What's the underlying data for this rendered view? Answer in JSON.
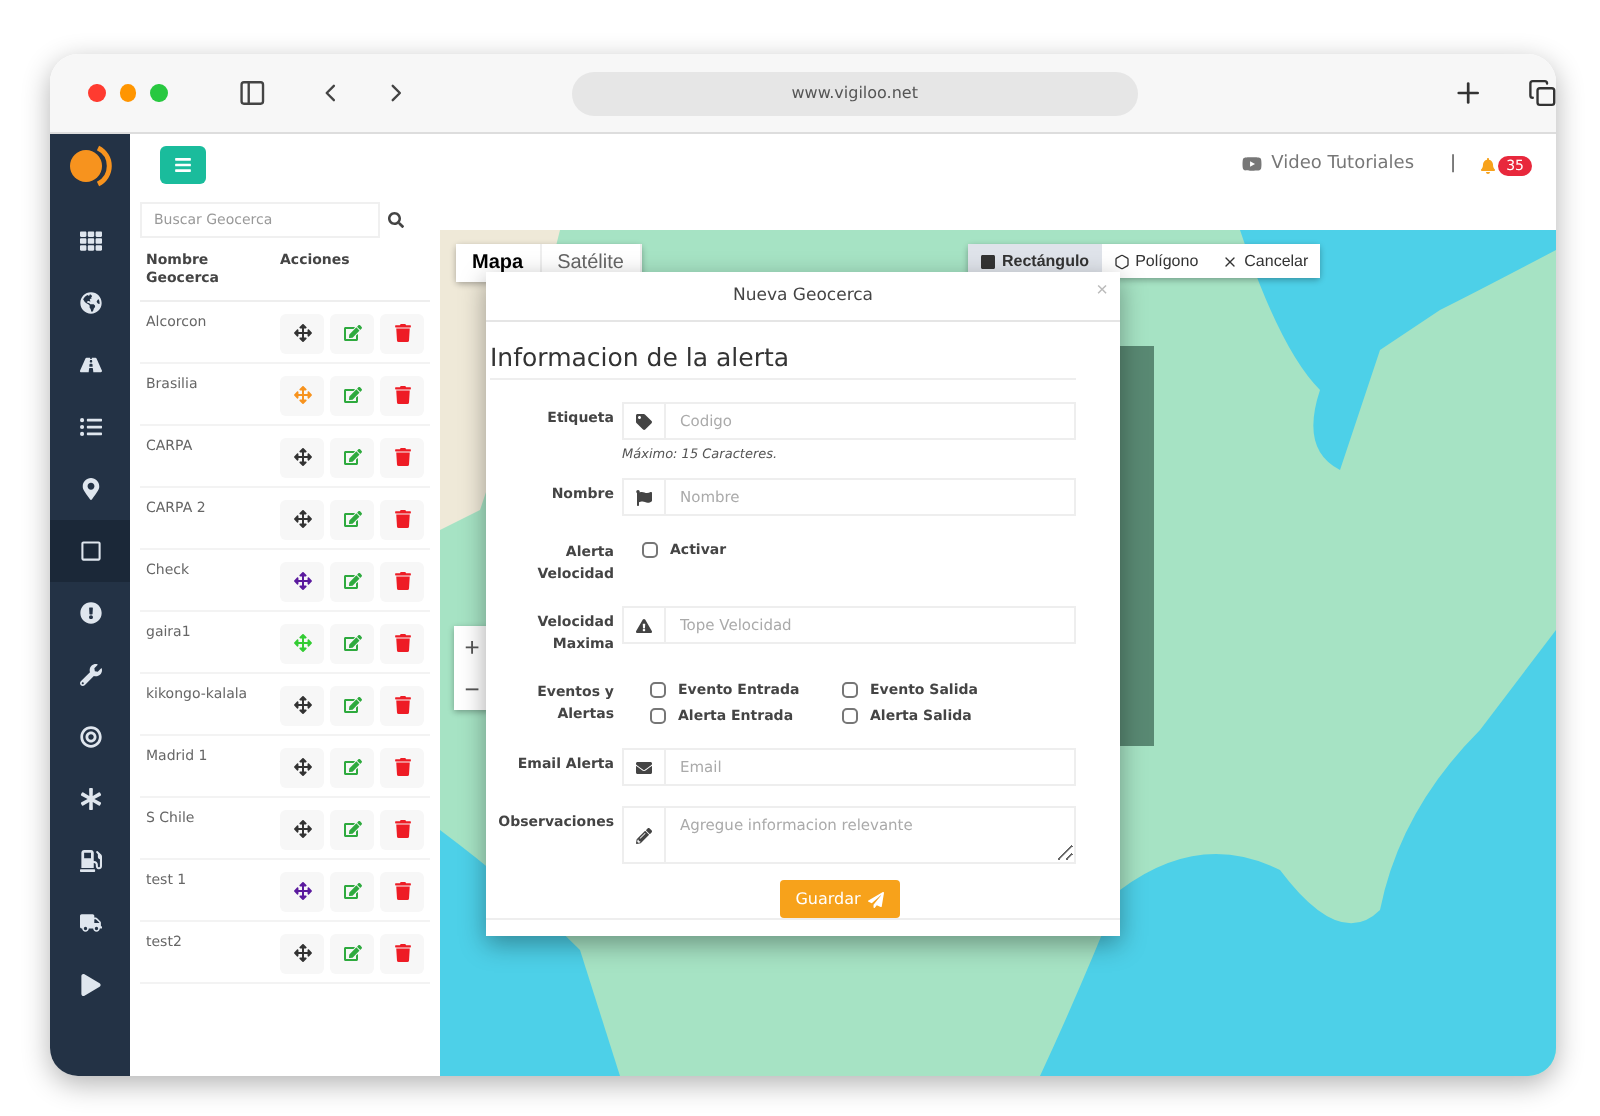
{
  "browser": {
    "url": "www.vigiloo.net"
  },
  "sidebar": {
    "items": [
      {
        "selected": false
      },
      {
        "selected": false
      },
      {
        "selected": false
      },
      {
        "selected": false
      },
      {
        "selected": false
      },
      {
        "selected": true
      },
      {
        "selected": false
      },
      {
        "selected": false
      },
      {
        "selected": false
      },
      {
        "selected": false
      },
      {
        "selected": false
      },
      {
        "selected": false
      },
      {
        "selected": false
      }
    ]
  },
  "header": {
    "video_link": "Video Tutoriales",
    "separator": "|",
    "notification_count": "35"
  },
  "geofence_panel": {
    "search_placeholder": "Buscar Geocerca",
    "columns": [
      "Nombre Geocerca",
      "Acciones"
    ],
    "rows": [
      {
        "name": "Alcorcon",
        "color": "#333333"
      },
      {
        "name": "Brasilia",
        "color": "#f7931e"
      },
      {
        "name": "CARPA",
        "color": "#333333"
      },
      {
        "name": "CARPA 2",
        "color": "#333333"
      },
      {
        "name": "Check",
        "color": "#5b1a9e"
      },
      {
        "name": "gaira1",
        "color": "#33cc33"
      },
      {
        "name": "kikongo-kalala",
        "color": "#333333"
      },
      {
        "name": "Madrid 1",
        "color": "#333333"
      },
      {
        "name": "S Chile",
        "color": "#333333"
      },
      {
        "name": "test 1",
        "color": "#5b1a9e"
      },
      {
        "name": "test2",
        "color": "#333333"
      }
    ]
  },
  "map": {
    "map_types": [
      {
        "label": "Mapa",
        "selected": true
      },
      {
        "label": "Satélite",
        "selected": false
      }
    ],
    "draw_tools": [
      {
        "label": "Rectángulo",
        "selected": true
      },
      {
        "label": "Polígono",
        "selected": false
      },
      {
        "label": "Cancelar",
        "selected": false
      }
    ],
    "zoom": [
      "+",
      "−"
    ]
  },
  "modal": {
    "title": "Nueva Geocerca",
    "close": "×",
    "section_title": "Informacion de la alerta",
    "fields": [
      {
        "kind": "input",
        "label": "Etiqueta",
        "placeholder": "Codigo",
        "hint": "Máximo: 15 Caracteres."
      },
      {
        "kind": "input",
        "label": "Nombre",
        "placeholder": "Nombre"
      },
      {
        "kind": "checks",
        "label": "Alerta Velocidad",
        "options": [
          {
            "label": "Activar",
            "checked": false
          }
        ]
      },
      {
        "kind": "input",
        "label": "Velocidad Maxima",
        "placeholder": "Tope Velocidad"
      },
      {
        "kind": "checks",
        "label": "Eventos y Alertas",
        "options": [
          {
            "label": "Evento Entrada",
            "checked": false
          },
          {
            "label": "Evento Salida",
            "checked": false
          },
          {
            "label": "Alerta Entrada",
            "checked": false
          },
          {
            "label": "Alerta Salida",
            "checked": false
          }
        ]
      },
      {
        "kind": "input",
        "label": "Email Alerta",
        "placeholder": "Email"
      },
      {
        "kind": "textarea",
        "label": "Observaciones",
        "placeholder": "Agregue informacion relevante"
      }
    ],
    "submit": "Guardar"
  }
}
